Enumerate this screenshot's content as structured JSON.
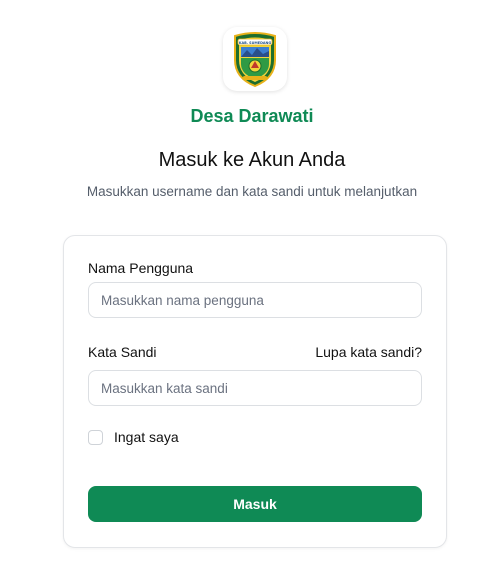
{
  "brand": {
    "name": "Desa Darawati",
    "logo_icon": "village-emblem-icon",
    "logo_text": "KAB. SUMEDANG"
  },
  "heading": "Masuk ke Akun Anda",
  "subheading": "Masukkan username dan kata sandi untuk melanjutkan",
  "form": {
    "username": {
      "label": "Nama Pengguna",
      "placeholder": "Masukkan nama pengguna",
      "value": ""
    },
    "password": {
      "label": "Kata Sandi",
      "placeholder": "Masukkan kata sandi",
      "value": "",
      "forgot_link": "Lupa kata sandi?"
    },
    "remember": {
      "label": "Ingat saya",
      "checked": false
    },
    "submit_label": "Masuk"
  },
  "colors": {
    "accent": "#0f8a55",
    "text": "#111111",
    "muted": "#555e6b",
    "border": "#dcdfe3"
  }
}
